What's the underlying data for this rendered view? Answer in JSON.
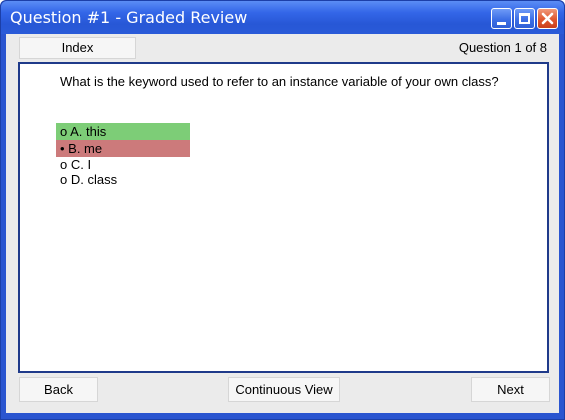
{
  "window": {
    "title": "Question #1 - Graded Review",
    "controls": [
      "minimize-icon",
      "maximize-icon",
      "close-icon"
    ]
  },
  "header": {
    "index_tab": "Index",
    "counter": "Question 1 of 8"
  },
  "question": {
    "text": "What is the keyword used to refer to an instance variable of your own class?",
    "options": [
      {
        "label": "o A. this",
        "status": "correct"
      },
      {
        "label": "• B. me",
        "status": "wrong"
      },
      {
        "label": "o C. I",
        "status": "none"
      },
      {
        "label": "o D. class",
        "status": "none"
      }
    ]
  },
  "footer": {
    "back_label": "Back",
    "continuous_label": "Continuous View",
    "next_label": "Next"
  },
  "colors": {
    "correct": "#7dcd77",
    "wrong": "#cc7a7b",
    "titlebar": "#2757d6",
    "panel_border": "#1f3a8a"
  }
}
